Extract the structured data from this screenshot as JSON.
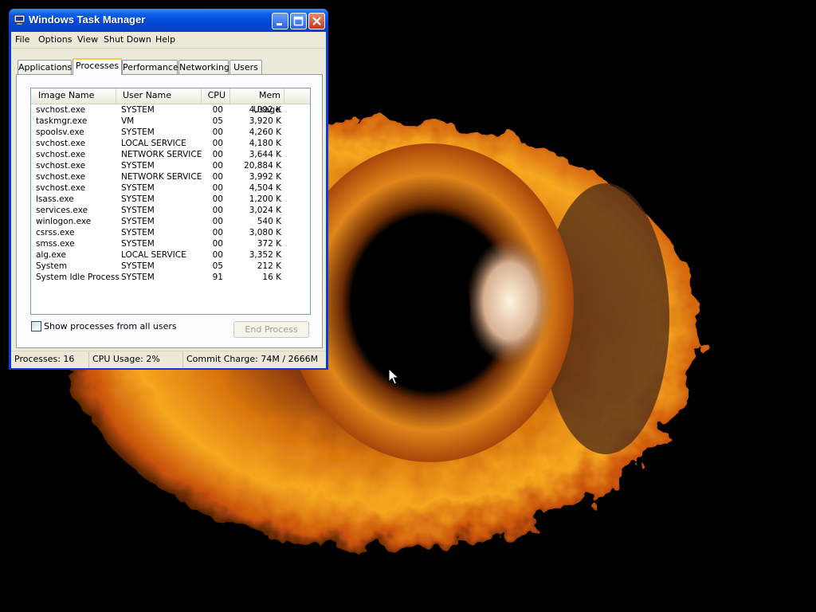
{
  "window": {
    "title": "Windows Task Manager"
  },
  "menu": [
    "File",
    "Options",
    "View",
    "Shut Down",
    "Help"
  ],
  "tabs": [
    "Applications",
    "Processes",
    "Performance",
    "Networking",
    "Users"
  ],
  "active_tab": "Processes",
  "processes": {
    "columns": [
      "Image Name",
      "User Name",
      "CPU",
      "Mem Usage"
    ],
    "rows": [
      [
        "svchost.exe",
        "SYSTEM",
        "00",
        "4,092 K"
      ],
      [
        "taskmgr.exe",
        "VM",
        "05",
        "3,920 K"
      ],
      [
        "spoolsv.exe",
        "SYSTEM",
        "00",
        "4,260 K"
      ],
      [
        "svchost.exe",
        "LOCAL SERVICE",
        "00",
        "4,180 K"
      ],
      [
        "svchost.exe",
        "NETWORK SERVICE",
        "00",
        "3,644 K"
      ],
      [
        "svchost.exe",
        "SYSTEM",
        "00",
        "20,884 K"
      ],
      [
        "svchost.exe",
        "NETWORK SERVICE",
        "00",
        "3,992 K"
      ],
      [
        "svchost.exe",
        "SYSTEM",
        "00",
        "4,504 K"
      ],
      [
        "lsass.exe",
        "SYSTEM",
        "00",
        "1,200 K"
      ],
      [
        "services.exe",
        "SYSTEM",
        "00",
        "3,024 K"
      ],
      [
        "winlogon.exe",
        "SYSTEM",
        "00",
        "540 K"
      ],
      [
        "csrss.exe",
        "SYSTEM",
        "00",
        "3,080 K"
      ],
      [
        "smss.exe",
        "SYSTEM",
        "00",
        "372 K"
      ],
      [
        "alg.exe",
        "LOCAL SERVICE",
        "00",
        "3,352 K"
      ],
      [
        "System",
        "SYSTEM",
        "05",
        "212 K"
      ],
      [
        "System Idle Process",
        "SYSTEM",
        "91",
        "16 K"
      ]
    ]
  },
  "show_all_label": "Show processes from all users",
  "show_all_checked": false,
  "end_process_label": "End Process",
  "status": {
    "processes": "Processes: 16",
    "cpu": "CPU Usage: 2%",
    "commit": "Commit Charge: 74M / 2666M"
  },
  "colors": {
    "titlebar": "#0a5ce6",
    "client": "#ece9d8",
    "desktop": "#000000"
  }
}
